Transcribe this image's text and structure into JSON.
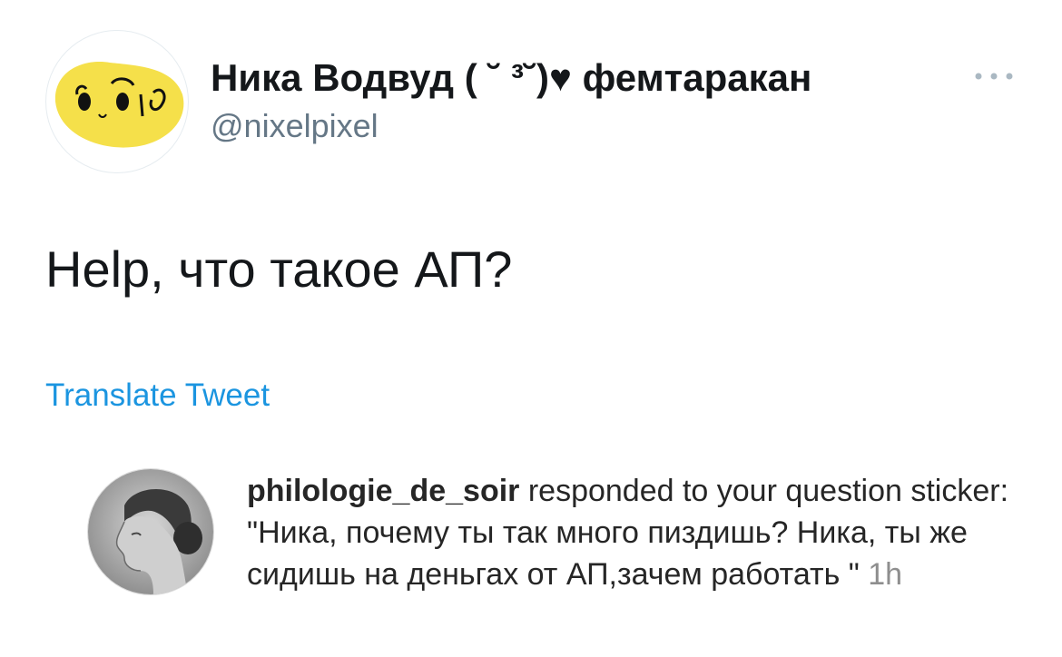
{
  "tweet": {
    "display_name": "Ника Водвуд ( ˘ ³˘)♥ фемтаракан",
    "handle": "@nixelpixel",
    "avatar_icon": "cartoon-face-icon",
    "more_icon": "more-dots-icon",
    "text": "Help, что такое АП?",
    "translate_label": "Translate Tweet",
    "accent_color": "#1b95e0"
  },
  "instagram_response": {
    "avatar_icon": "portrait-photo",
    "username": "philologie_de_soir",
    "action_text": " responded to your question sticker: \"Ника, почему ты так много пиздишь? Ника, ты же сидишь на деньгах от АП,зачем работать \" ",
    "time": "1h"
  }
}
